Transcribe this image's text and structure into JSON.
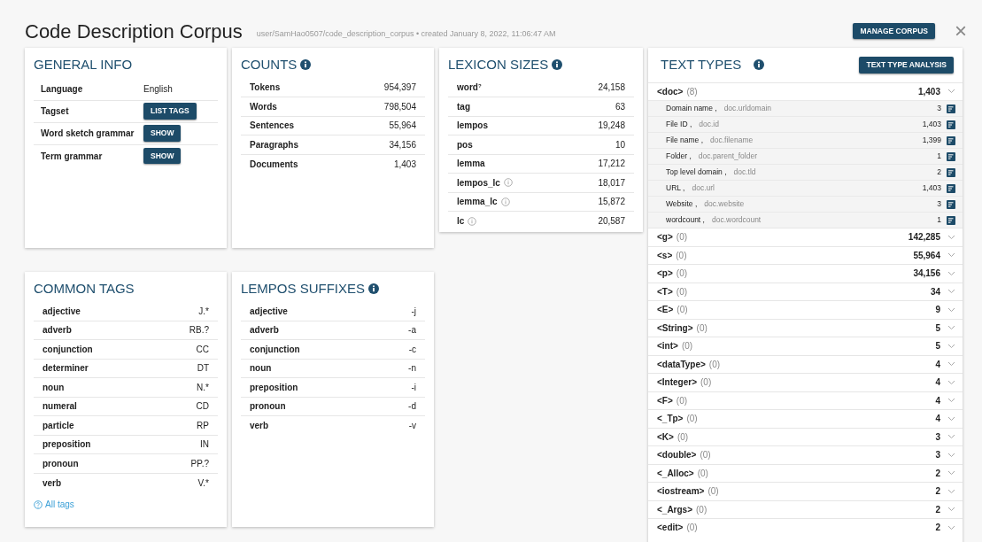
{
  "header": {
    "title": "Code Description Corpus",
    "subtitle": "user/SamHao0507/code_description_corpus • created January 8, 2022, 11:06:47 AM",
    "manage_button": "MANAGE CORPUS",
    "close": "×"
  },
  "general_info": {
    "title": "GENERAL INFO",
    "rows": [
      {
        "kind": "text",
        "label": "Language",
        "value": "English"
      },
      {
        "kind": "button",
        "label": "Tagset",
        "value": "LIST TAGS"
      },
      {
        "kind": "button",
        "label": "Word sketch grammar",
        "value": "SHOW"
      },
      {
        "kind": "button",
        "label": "Term grammar",
        "value": "SHOW"
      }
    ]
  },
  "counts": {
    "title": "COUNTS",
    "rows": [
      {
        "label": "Tokens",
        "value": "954,397"
      },
      {
        "label": "Words",
        "value": "798,504"
      },
      {
        "label": "Sentences",
        "value": "55,964"
      },
      {
        "label": "Paragraphs",
        "value": "34,156"
      },
      {
        "label": "Documents",
        "value": "1,403"
      }
    ]
  },
  "lexicon_sizes": {
    "title": "LEXICON SIZES",
    "rows": [
      {
        "label": "word$^{?}$",
        "value": "24,158",
        "info": false
      },
      {
        "label": "tag",
        "value": "63",
        "info": false
      },
      {
        "label": "lempos",
        "value": "19,248",
        "info": false
      },
      {
        "label": "pos",
        "value": "10",
        "info": false
      },
      {
        "label": "lemma",
        "value": "17,212",
        "info": false
      },
      {
        "label": "lempos_lc",
        "value": "18,017",
        "info": true
      },
      {
        "label": "lemma_lc",
        "value": "15,872",
        "info": true
      },
      {
        "label": "lc",
        "value": "20,587",
        "info": true
      }
    ]
  },
  "common_tags": {
    "title": "COMMON TAGS",
    "rows": [
      {
        "label": "adjective",
        "value": "J.*"
      },
      {
        "label": "adverb",
        "value": "RB.?"
      },
      {
        "label": "conjunction",
        "value": "CC"
      },
      {
        "label": "determiner",
        "value": "DT"
      },
      {
        "label": "noun",
        "value": "N.*"
      },
      {
        "label": "numeral",
        "value": "CD"
      },
      {
        "label": "particle",
        "value": "RP"
      },
      {
        "label": "preposition",
        "value": "IN"
      },
      {
        "label": "pronoun",
        "value": "PP.?"
      },
      {
        "label": "verb",
        "value": "V.*"
      }
    ],
    "link": "All tags"
  },
  "lempos_suffixes": {
    "title": "LEMPOS SUFFIXES",
    "rows": [
      {
        "label": "adjective",
        "value": "-j"
      },
      {
        "label": "adverb",
        "value": "-a"
      },
      {
        "label": "conjunction",
        "value": "-c"
      },
      {
        "label": "noun",
        "value": "-n"
      },
      {
        "label": "preposition",
        "value": "-i"
      },
      {
        "label": "pronoun",
        "value": "-d"
      },
      {
        "label": "verb",
        "value": "-v"
      }
    ]
  },
  "text_types": {
    "title": "TEXT TYPES",
    "button": "TEXT TYPE ANALYSIS",
    "structures": [
      {
        "name": "<doc>",
        "attr_count": "(8)",
        "value": "1,403",
        "children": [
          {
            "label": "Domain name ,",
            "attr": "doc.urldomain",
            "value": "3"
          },
          {
            "label": "File ID ,",
            "attr": "doc.id",
            "value": "1,403"
          },
          {
            "label": "File name ,",
            "attr": "doc.filename",
            "value": "1,399"
          },
          {
            "label": "Folder ,",
            "attr": "doc.parent_folder",
            "value": "1"
          },
          {
            "label": "Top level domain ,",
            "attr": "doc.tld",
            "value": "2"
          },
          {
            "label": "URL ,",
            "attr": "doc.url",
            "value": "1,403"
          },
          {
            "label": "Website ,",
            "attr": "doc.website",
            "value": "3"
          },
          {
            "label": "wordcount ,",
            "attr": "doc.wordcount",
            "value": "1"
          }
        ]
      },
      {
        "name": "<g>",
        "attr_count": "(0)",
        "value": "142,285"
      },
      {
        "name": "<s>",
        "attr_count": "(0)",
        "value": "55,964"
      },
      {
        "name": "<p>",
        "attr_count": "(0)",
        "value": "34,156"
      },
      {
        "name": "<T>",
        "attr_count": "(0)",
        "value": "34"
      },
      {
        "name": "<E>",
        "attr_count": "(0)",
        "value": "9"
      },
      {
        "name": "<String>",
        "attr_count": "(0)",
        "value": "5"
      },
      {
        "name": "<int>",
        "attr_count": "(0)",
        "value": "5"
      },
      {
        "name": "<dataType>",
        "attr_count": "(0)",
        "value": "4"
      },
      {
        "name": "<Integer>",
        "attr_count": "(0)",
        "value": "4"
      },
      {
        "name": "<F>",
        "attr_count": "(0)",
        "value": "4"
      },
      {
        "name": "<_Tp>",
        "attr_count": "(0)",
        "value": "4"
      },
      {
        "name": "<K>",
        "attr_count": "(0)",
        "value": "3"
      },
      {
        "name": "<double>",
        "attr_count": "(0)",
        "value": "3"
      },
      {
        "name": "<_Alloc>",
        "attr_count": "(0)",
        "value": "2"
      },
      {
        "name": "<iostream>",
        "attr_count": "(0)",
        "value": "2"
      },
      {
        "name": "<_Args>",
        "attr_count": "(0)",
        "value": "2"
      },
      {
        "name": "<edit>",
        "attr_count": "(0)",
        "value": "2"
      }
    ]
  }
}
